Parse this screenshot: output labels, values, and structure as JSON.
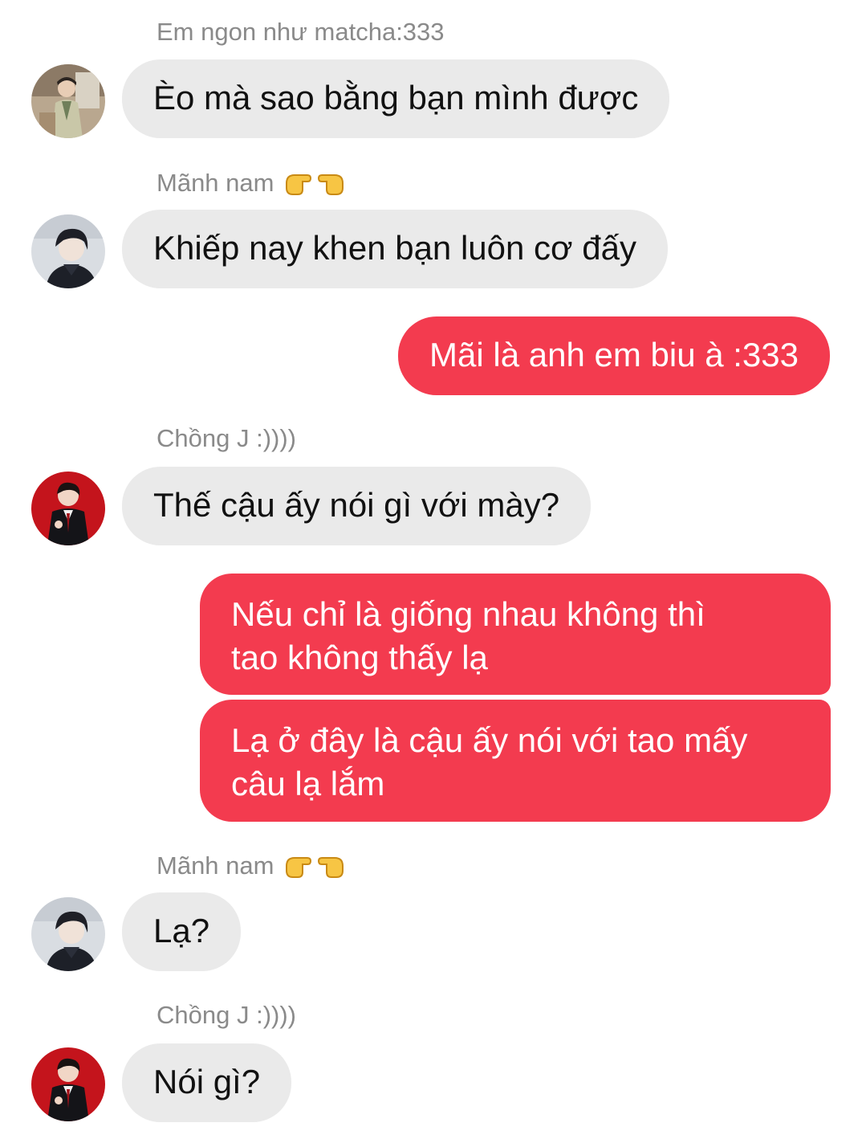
{
  "colors": {
    "incoming_bubble": "#eaeaea",
    "outgoing_bubble": "#f33b4f",
    "sender_name": "#8a8a8a",
    "incoming_text": "#111111",
    "outgoing_text": "#ffffff"
  },
  "messages": [
    {
      "direction": "incoming",
      "sender": "Em ngon như matcha:333",
      "avatar": "avatar-matcha",
      "text": "Èo mà sao bằng bạn mình được"
    },
    {
      "direction": "incoming",
      "sender": "Mãnh nam",
      "sender_emoji": "pointing-hands-emoji",
      "avatar": "avatar-manh-nam",
      "text": "Khiếp nay khen bạn luôn cơ đấy"
    },
    {
      "direction": "outgoing",
      "text": "Mãi là anh em biu à :333"
    },
    {
      "direction": "incoming",
      "sender": "Chồng J :))))",
      "avatar": "avatar-chong-j",
      "text": "Thế cậu ấy nói gì với mày?"
    },
    {
      "direction": "outgoing",
      "text_lines": [
        "Nếu chỉ là giống nhau không thì",
        "tao không thấy lạ"
      ]
    },
    {
      "direction": "outgoing",
      "text_lines": [
        "Lạ ở đây là cậu ấy nói với tao mấy",
        "câu lạ lắm"
      ]
    },
    {
      "direction": "incoming",
      "sender": "Mãnh nam",
      "sender_emoji": "pointing-hands-emoji",
      "avatar": "avatar-manh-nam",
      "text": "Lạ?"
    },
    {
      "direction": "incoming",
      "sender": "Chồng J :))))",
      "avatar": "avatar-chong-j",
      "text": "Nói gì?"
    }
  ]
}
